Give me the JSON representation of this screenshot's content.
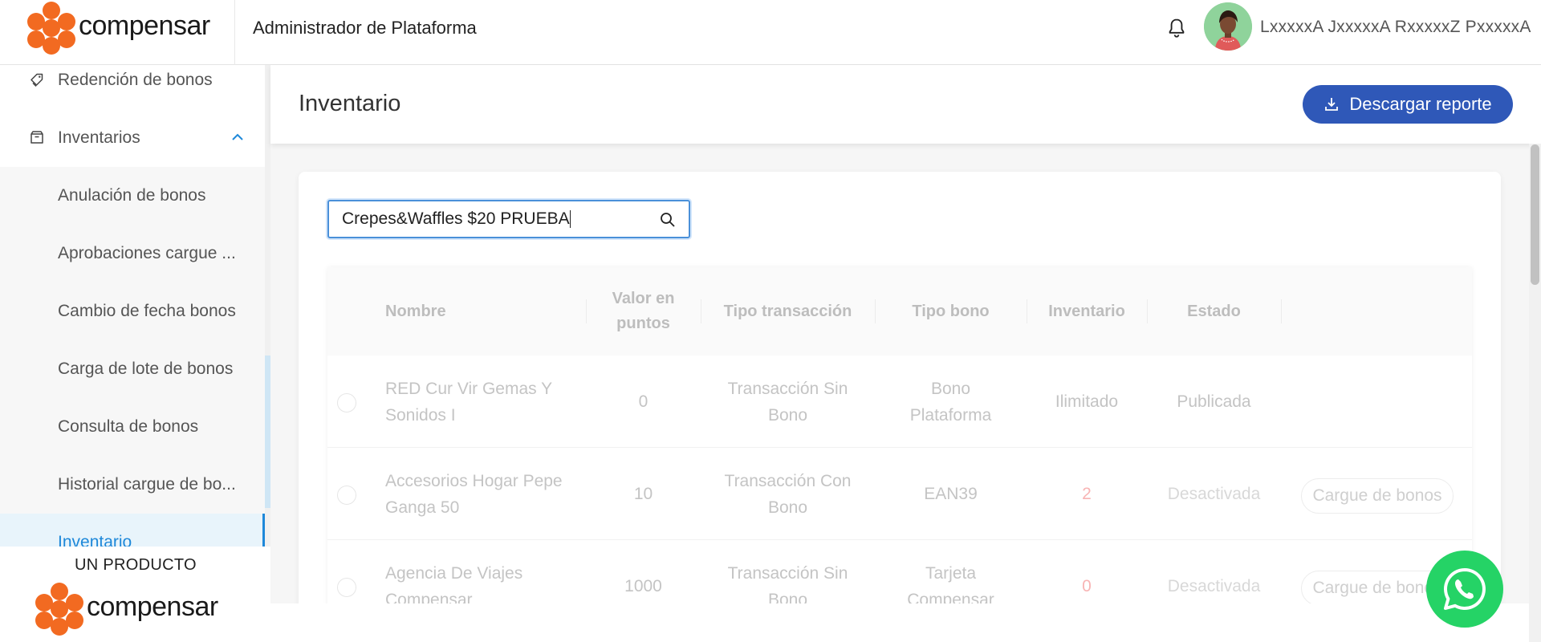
{
  "brand": {
    "logo_text": "compensar",
    "accent": "#f26a21",
    "tagline": "UN PRODUCTO"
  },
  "header": {
    "title": "Administrador de Plataforma",
    "user_name": "LxxxxxA JxxxxxA RxxxxxZ PxxxxxA",
    "icons": [
      "bell-icon",
      "user-avatar"
    ]
  },
  "sidebar": {
    "items": [
      {
        "label": "Redención de bonos",
        "icon": "tag-icon"
      },
      {
        "label": "Inventarios",
        "icon": "box-icon",
        "expanded": true
      }
    ],
    "subitems": [
      {
        "label": "Anulación de bonos"
      },
      {
        "label": "Aprobaciones cargue ..."
      },
      {
        "label": "Cambio de fecha bonos"
      },
      {
        "label": "Carga de lote de bonos"
      },
      {
        "label": "Consulta de bonos"
      },
      {
        "label": "Historial cargue de bo..."
      },
      {
        "label": "Inventario",
        "active": true
      }
    ],
    "active_color": "#1e88d9"
  },
  "page": {
    "title": "Inventario",
    "download_button": "Descargar reporte",
    "button_color": "#2f58b8"
  },
  "search": {
    "value": "Crepes&Waffles $20 PRUEBA"
  },
  "table": {
    "headers": [
      "Nombre",
      "Valor en puntos",
      "Tipo transacción",
      "Tipo bono",
      "Inventario",
      "Estado"
    ],
    "rows": [
      {
        "nombre": "RED Cur Vir Gemas Y Sonidos I",
        "valor": "0",
        "tipo_transaccion": "Transacción Sin Bono",
        "tipo_bono": "Bono Plataforma",
        "inventario": "Ilimitado",
        "estado": "Publicada",
        "action": ""
      },
      {
        "nombre": "Accesorios Hogar Pepe Ganga 50",
        "valor": "10",
        "tipo_transaccion": "Transacción Con Bono",
        "tipo_bono": "EAN39",
        "inventario": "2",
        "estado": "Desactivada",
        "action": "Cargue de bonos"
      },
      {
        "nombre": "Agencia De Viajes Compensar",
        "valor": "1000",
        "tipo_transaccion": "Transacción Sin Bono",
        "tipo_bono": "Tarjeta Compensar",
        "inventario": "0",
        "estado": "Desactivada",
        "action": "Cargue de bonos"
      }
    ]
  },
  "whatsapp_color": "#25d366"
}
